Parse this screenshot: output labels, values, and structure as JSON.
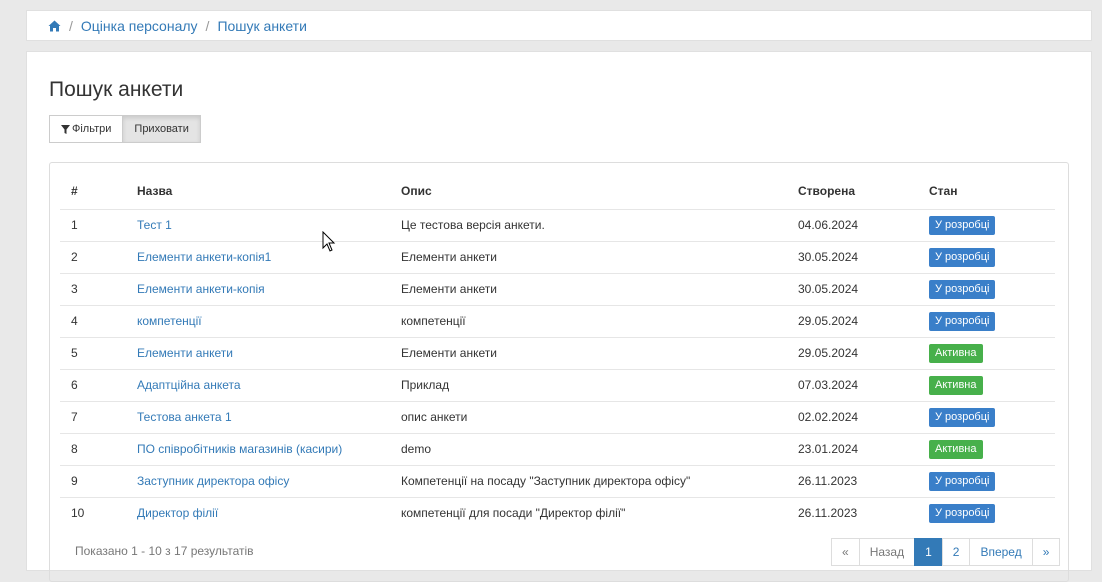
{
  "breadcrumb": {
    "icon": "home-icon",
    "items": [
      "Оцінка персоналу",
      "Пошук анкети"
    ],
    "separator": "/"
  },
  "page": {
    "title": "Пошук анкети"
  },
  "toolbar": {
    "filters_label": "Фільтри",
    "hide_label": "Приховати",
    "filter_icon": "filter-icon"
  },
  "table": {
    "headers": [
      "#",
      "Назва",
      "Опис",
      "Створена",
      "Стан"
    ],
    "rows": [
      {
        "num": "1",
        "name": "Тест 1",
        "desc": "Це тестова версія анкети.",
        "created": "04.06.2024",
        "status": "У розробці",
        "status_color": "#3a7fc9"
      },
      {
        "num": "2",
        "name": "Елементи анкети-копія1",
        "desc": "Елементи анкети",
        "created": "30.05.2024",
        "status": "У розробці",
        "status_color": "#3a7fc9"
      },
      {
        "num": "3",
        "name": "Елементи анкети-копія",
        "desc": "Елементи анкети",
        "created": "30.05.2024",
        "status": "У розробці",
        "status_color": "#3a7fc9"
      },
      {
        "num": "4",
        "name": "компетенції",
        "desc": "компетенції",
        "created": "29.05.2024",
        "status": "У розробці",
        "status_color": "#3a7fc9"
      },
      {
        "num": "5",
        "name": "Елементи анкети",
        "desc": "Елементи анкети",
        "created": "29.05.2024",
        "status": "Активна",
        "status_color": "#47b04b"
      },
      {
        "num": "6",
        "name": "Адаптційна анкета",
        "desc": "Приклад",
        "created": "07.03.2024",
        "status": "Активна",
        "status_color": "#47b04b"
      },
      {
        "num": "7",
        "name": "Тестова анкета 1",
        "desc": "опис анкети",
        "created": "02.02.2024",
        "status": "У розробці",
        "status_color": "#3a7fc9"
      },
      {
        "num": "8",
        "name": "ПО співробітників магазинів (касири)",
        "desc": "demo",
        "created": "23.01.2024",
        "status": "Активна",
        "status_color": "#47b04b"
      },
      {
        "num": "9",
        "name": "Заступник директора офісу",
        "desc": "Компетенції на посаду \"Заступник директора офісу\"",
        "created": "26.11.2023",
        "status": "У розробці",
        "status_color": "#3a7fc9"
      },
      {
        "num": "10",
        "name": "Директор філії",
        "desc": "компетенції для посади \"Директор філії\"",
        "created": "26.11.2023",
        "status": "У розробці",
        "status_color": "#3a7fc9"
      }
    ]
  },
  "footer": {
    "summary": "Показано 1 - 10 з 17 результатів",
    "pagination": {
      "first": "«",
      "prev": "Назад",
      "pages": [
        "1",
        "2"
      ],
      "current": "1",
      "next": "Вперед",
      "last": "»"
    }
  }
}
